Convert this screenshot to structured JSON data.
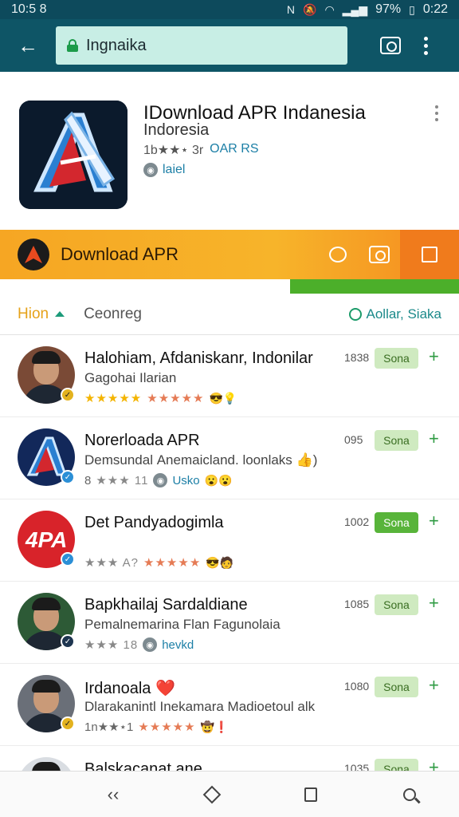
{
  "status_bar": {
    "time_left": "10:5 8",
    "battery": "97%",
    "time_right": "0:22"
  },
  "app_bar": {
    "url": "Ingnaika"
  },
  "app": {
    "title": "IDownload APR Indanesia",
    "subtitle": "Indoresia",
    "meta_prefix": "1b★★⋆ 3r",
    "meta_link": "OAR RS",
    "tag": "laiel"
  },
  "banner": {
    "title": "Download APR"
  },
  "tabs": {
    "active": "Hion",
    "inactive": "Ceonreg",
    "right": "Aollar, Siaka"
  },
  "list": [
    {
      "title": "Halohiam, Afdaniskanr, Indonilar",
      "sub": "Gagohai Ilarian",
      "meta": "",
      "count": "1838",
      "pill": "Sona",
      "strong": false,
      "avatar": "photo",
      "badge": "gold",
      "stars_gold": "★★★★★",
      "stars_gray": "",
      "stars_red": "★★★★★",
      "emoji": "😎💡",
      "link": ""
    },
    {
      "title": "Norerloada APR",
      "sub": "Demsundal Anemaicland. loonlaks 👍)",
      "meta": "8",
      "count": "095",
      "pill": "Sona",
      "strong": false,
      "avatar": "logo",
      "badge": "blue",
      "stars_gold": "",
      "stars_gray": "★★★ 11",
      "stars_red": "",
      "emoji": "😮😮",
      "link": "Usko"
    },
    {
      "title": "Det Pandyadogimla",
      "sub": "",
      "meta": "",
      "count": "1002",
      "pill": "Sona",
      "strong": true,
      "avatar": "red-logo",
      "badge": "blue",
      "stars_gold": "",
      "stars_gray": "★★★ A?",
      "stars_red": "★★★★★",
      "emoji": "😎🧑",
      "link": ""
    },
    {
      "title": "Bapkhailaj Sardaldiane",
      "sub": "Pemalnemarina Flan Fagunolaia",
      "meta": "",
      "count": "1085",
      "pill": "Sona",
      "strong": false,
      "avatar": "photo",
      "badge": "dark",
      "stars_gold": "",
      "stars_gray": "★★★ 18",
      "stars_red": "",
      "emoji": "",
      "link": "hevkd"
    },
    {
      "title": "Irdanoala ❤️",
      "sub": "Dlarakanintl Inekamara Madioetoul alk",
      "meta": "1n★★⋆1",
      "count": "1080",
      "pill": "Sona",
      "strong": false,
      "avatar": "photo",
      "badge": "gold",
      "stars_gold": "",
      "stars_gray": "",
      "stars_red": "★★★★★",
      "emoji": "🤠❗",
      "link": ""
    },
    {
      "title": "Balskacanat ane",
      "sub": "",
      "meta": "",
      "count": "1035",
      "pill": "Sona",
      "strong": false,
      "avatar": "photo",
      "badge": "blue",
      "stars_gold": "",
      "stars_gray": "",
      "stars_red": "",
      "emoji": "",
      "link": ""
    }
  ]
}
